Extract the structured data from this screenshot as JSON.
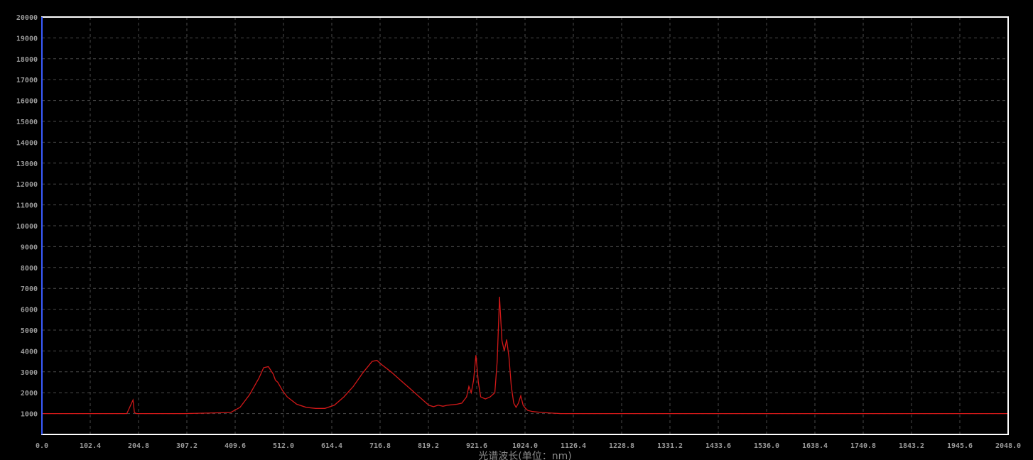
{
  "chart_data": {
    "type": "line",
    "title": "",
    "xlabel": "光谱波长(单位：nm)",
    "ylabel": "",
    "xlim": [
      0,
      2048
    ],
    "ylim": [
      0,
      20000
    ],
    "x_ticks": [
      "0.0",
      "102.4",
      "204.8",
      "307.2",
      "409.6",
      "512.0",
      "614.4",
      "716.8",
      "819.2",
      "921.6",
      "1024.0",
      "1126.4",
      "1228.8",
      "1331.2",
      "1433.6",
      "1536.0",
      "1638.4",
      "1740.8",
      "1843.2",
      "1945.6",
      "2048.0"
    ],
    "y_ticks": [
      "1000",
      "2000",
      "3000",
      "4000",
      "5000",
      "6000",
      "7000",
      "8000",
      "9000",
      "10000",
      "11000",
      "12000",
      "13000",
      "14000",
      "15000",
      "16000",
      "17000",
      "18000",
      "19000",
      "20000"
    ],
    "grid": true,
    "legend": "none",
    "colors": {
      "background": "#000000",
      "plot_border": "#ffffff",
      "left_axis": "#3a5cff",
      "grid": "#4a4a4a",
      "series": "#d01818"
    },
    "series": [
      {
        "x": [
          0,
          100,
          180,
          193,
          196,
          200,
          210,
          300,
          400,
          420,
          440,
          460,
          470,
          480,
          490,
          495,
          500,
          510,
          520,
          540,
          560,
          580,
          600,
          620,
          640,
          660,
          680,
          700,
          710,
          720,
          740,
          760,
          780,
          800,
          820,
          830,
          840,
          850,
          860,
          880,
          890,
          900,
          905,
          910,
          915,
          920,
          925,
          930,
          940,
          950,
          960,
          965,
          970,
          975,
          980,
          985,
          990,
          995,
          1000,
          1005,
          1010,
          1015,
          1020,
          1025,
          1030,
          1040,
          1060,
          1100,
          1200,
          1300,
          1400,
          1500,
          1600,
          1700,
          1800,
          1900,
          2000,
          2048
        ],
        "y": [
          1000,
          1000,
          1000,
          1650,
          1050,
          1000,
          1000,
          1000,
          1050,
          1300,
          1900,
          2700,
          3200,
          3250,
          2900,
          2600,
          2500,
          2100,
          1800,
          1450,
          1300,
          1250,
          1250,
          1400,
          1800,
          2300,
          2950,
          3500,
          3550,
          3350,
          3000,
          2600,
          2200,
          1800,
          1400,
          1330,
          1400,
          1350,
          1400,
          1450,
          1500,
          1800,
          2300,
          2000,
          2600,
          3800,
          2500,
          1800,
          1700,
          1800,
          2000,
          3500,
          6600,
          4500,
          4000,
          4550,
          3700,
          2300,
          1500,
          1300,
          1500,
          1850,
          1400,
          1250,
          1150,
          1100,
          1050,
          1000,
          1000,
          1000,
          1000,
          1000,
          1000,
          1000,
          1000,
          1000,
          1000,
          1000
        ]
      }
    ]
  }
}
